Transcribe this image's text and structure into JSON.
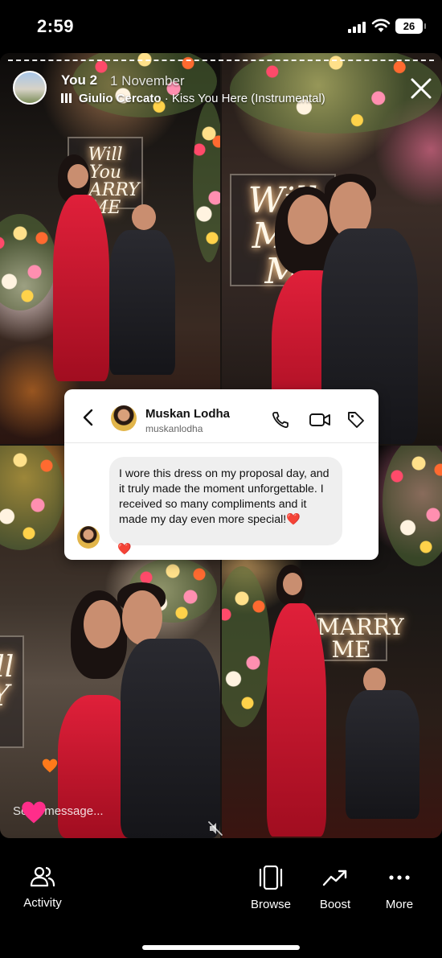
{
  "status_bar": {
    "time": "2:59",
    "battery": "26",
    "icons": [
      "signal-icon",
      "wifi-icon",
      "battery-icon"
    ]
  },
  "story": {
    "user": "You 2",
    "date": "1 November",
    "music": {
      "artist": "Giulio Cercato",
      "separator": " · ",
      "track": "Kiss You Here (Instrumental)"
    },
    "neon_signs": {
      "sign1": "Will You MARRY ME",
      "sign2": "Will MA M",
      "sign3": "MARRY ME",
      "sign4": "ill Y"
    }
  },
  "dm_card": {
    "name": "Muskan Lodha",
    "handle": "muskanlodha",
    "message": "I wore this dress on my proposal day, and it truly made the moment unforgettable. I received so many compliments and it made my day even more special!❤️",
    "reaction": "❤️",
    "icons": [
      "back-icon",
      "phone-icon",
      "video-icon",
      "tag-icon"
    ]
  },
  "reply": {
    "placeholder": "Send message..."
  },
  "bottom_bar": {
    "activity": "Activity",
    "browse": "Browse",
    "boost": "Boost",
    "more": "More"
  },
  "colors": {
    "background": "#000000",
    "dress_red": "#d81a32",
    "heart_pink": "#ff2d8a",
    "heart_orange": "#ff7a1a"
  }
}
